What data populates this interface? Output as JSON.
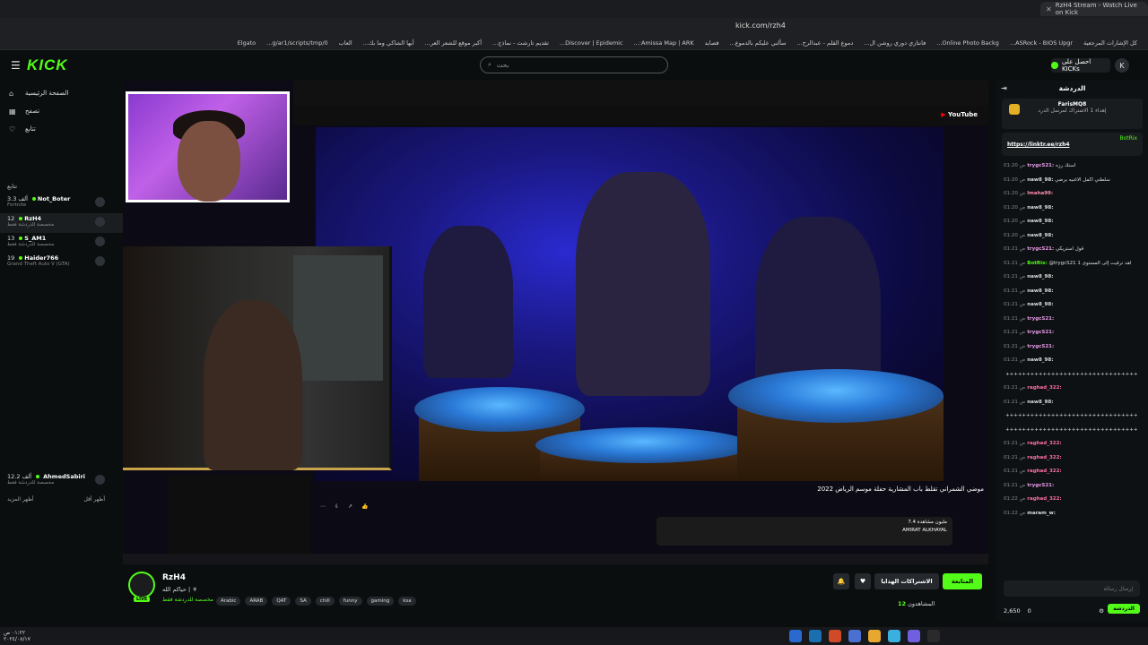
{
  "browser": {
    "tab_title": "RzH4 Stream - Watch Live on Kick",
    "url": "kick.com/rzh4",
    "bookmarks": [
      "كل الإشارات المرجعية",
      "ASRock - BIOS Upgr...",
      "Online Photo Backg...",
      "فانتازي دوري روشن ال...",
      "دموع القلم - عبدالرح...",
      "سألني عليكم بالدموع...",
      "قصايد",
      "Amissa Map | ARK:...",
      "Discover | Epidemic...",
      "تقديم تارشت - نماذج...",
      "أكبر موقع للشعر العر...",
      "أبها الشاكي وما بك...",
      "العاب",
      "g/ar1/scripts/tmp/0...",
      "Elgato"
    ]
  },
  "header": {
    "logo": "KICK",
    "search_placeholder": "بحث",
    "get_kicks": "احصل على KICKs"
  },
  "sidebar": {
    "nav": [
      {
        "label": "الصفحة الرئيسية",
        "icon": "home-icon"
      },
      {
        "label": "تصفح",
        "icon": "browse-icon"
      },
      {
        "label": "تتابع",
        "icon": "heart-icon"
      }
    ],
    "following_title": "تتابع",
    "channels": [
      {
        "name": "Not_Boter",
        "viewers": "3.3 ألف",
        "category": "Fortnite"
      },
      {
        "name": "RzH4",
        "viewers": "12",
        "category": "مخصصة للدردشة فقط"
      },
      {
        "name": "S_AM1",
        "viewers": "13",
        "category": "مخصصة للدردشة فقط"
      },
      {
        "name": "Haider766",
        "viewers": "19",
        "category": "Grand Theft Auto V (GTA)"
      }
    ],
    "channel_bottom": {
      "name": "AhmedSabiri",
      "viewers": "12.2 ألف",
      "category": "مخصصة للدردشة فقط"
    },
    "show_more": "أظهر المزيد",
    "show_less": "أظهر أقل"
  },
  "video": {
    "yt_logo": "YouTube",
    "yt_title": "موضي الشمراني تقلط باب المشارية حفلة موسم الرياض 2022",
    "yt_channel": "AMIRAT ALKHAYAL",
    "yt_views": "7.4 مليون مشاهدة"
  },
  "stream": {
    "name": "RzH4",
    "title": "حياكم الله | ⚜",
    "category": "مخصصة للدردشة فقط",
    "live": "LIVE",
    "tags": [
      "Arabic",
      "ARAB",
      "QAT",
      "SA",
      "chill",
      "funny",
      "gaming",
      "ksa"
    ],
    "follow": "المتابعة",
    "subscriptions": "الاشتراكات الهدايا",
    "watching_label": "المشاهدون",
    "watching_count": "12"
  },
  "chat": {
    "title": "الدردشة",
    "pinned_user": "FarisMQ8",
    "pinned_text": "إهداء 1 الاشتراك لمرسل الدرد",
    "pinned_msg_user": "BotRix",
    "pinned_link": "https://linktr.ee/rzh4",
    "messages": [
      {
        "t": "01:20 ص",
        "u": "trygcS21:",
        "c": "#e89ae8",
        "m": "استك رزه"
      },
      {
        "t": "01:20 ص",
        "u": "naw8_98:",
        "c": "#ddd",
        "m": "سلطني اكمل الاغنيه برضي"
      },
      {
        "t": "01:20 ص",
        "u": "lmaha99:",
        "c": "#ff8fae",
        "m": ""
      },
      {
        "t": "01:20 ص",
        "u": "naw8_98:",
        "c": "#ddd",
        "m": ""
      },
      {
        "t": "01:20 ص",
        "u": "naw8_98:",
        "c": "#ddd",
        "m": ""
      },
      {
        "t": "01:20 ص",
        "u": "naw8_98:",
        "c": "#ddd",
        "m": ""
      },
      {
        "t": "01:21 ص",
        "u": "trygcS21:",
        "c": "#e89ae8",
        "m": "قول استريكي"
      },
      {
        "t": "01:21 ص",
        "u": "BotRix:",
        "c": "#53fc18",
        "m": "@trygcS21 لقد ترقيت إلى المستوى 1"
      },
      {
        "t": "01:21 ص",
        "u": "naw8_98:",
        "c": "#ddd",
        "m": ""
      },
      {
        "t": "01:21 ص",
        "u": "naw8_98:",
        "c": "#ddd",
        "m": ""
      },
      {
        "t": "01:21 ص",
        "u": "naw8_98:",
        "c": "#ddd",
        "m": ""
      },
      {
        "t": "01:21 ص",
        "u": "trygcS21:",
        "c": "#e89ae8",
        "m": ""
      },
      {
        "t": "01:21 ص",
        "u": "trygcS21:",
        "c": "#e89ae8",
        "m": ""
      },
      {
        "t": "01:21 ص",
        "u": "trygcS21:",
        "c": "#e89ae8",
        "m": ""
      },
      {
        "t": "01:21 ص",
        "u": "naw8_98:",
        "c": "#ddd",
        "m": ""
      },
      {
        "t": "",
        "u": "",
        "c": "#ddd",
        "m": "++++++++++++++++++++++++++++++++"
      },
      {
        "t": "01:21 ص",
        "u": "raghad_322:",
        "c": "#ff6fa8",
        "m": ""
      },
      {
        "t": "01:21 ص",
        "u": "naw8_98:",
        "c": "#ddd",
        "m": ""
      },
      {
        "t": "",
        "u": "",
        "c": "#ddd",
        "m": "++++++++++++++++++++++++++++++++"
      },
      {
        "t": "",
        "u": "",
        "c": "#ddd",
        "m": "++++++++++++++++++++++++++++++++"
      },
      {
        "t": "01:21 ص",
        "u": "raghad_322:",
        "c": "#ff6fa8",
        "m": ""
      },
      {
        "t": "01:21 ص",
        "u": "raghad_322:",
        "c": "#ff6fa8",
        "m": ""
      },
      {
        "t": "01:21 ص",
        "u": "raghad_322:",
        "c": "#ff6fa8",
        "m": ""
      },
      {
        "t": "01:21 ص",
        "u": "trygcS21:",
        "c": "#e89ae8",
        "m": ""
      },
      {
        "t": "01:22 ص",
        "u": "raghad_322:",
        "c": "#ff6fa8",
        "m": ""
      },
      {
        "t": "01:22 ص",
        "u": "maram_w:",
        "c": "#ddd",
        "m": ""
      }
    ],
    "input_placeholder": "إرسال رسالة",
    "points": "2,650",
    "zero": "0",
    "send": "الدردشة"
  },
  "os": {
    "time": "٠١:٢٢ ص",
    "date": "٢٠٢٤/٠٨/١٧"
  }
}
